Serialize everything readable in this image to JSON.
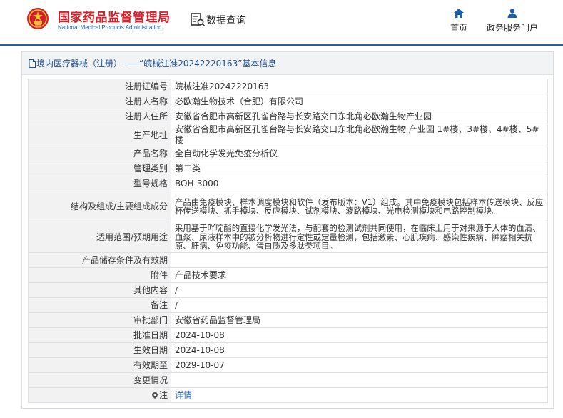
{
  "header": {
    "brand_cn": "国家药品监督管理局",
    "brand_en": "National Medical Products Administration",
    "database_label": "数据查询",
    "nav": [
      {
        "label": "首页",
        "icon": "home-icon"
      },
      {
        "label": "政务服务门户",
        "icon": "user-icon"
      }
    ]
  },
  "panel": {
    "title": "境内医疗器械（注册）——“皖械注准20242220163”基本信息",
    "rows": [
      {
        "key": "注册证编号",
        "value": "皖械注准20242220163"
      },
      {
        "key": "注册人名称",
        "value": "必欧瀚生物技术（合肥）有限公司"
      },
      {
        "key": "注册人住所",
        "value": "安徽省合肥市高新区孔雀台路与长安路交口东北角必欧瀚生物产业园"
      },
      {
        "key": "生产地址",
        "value": "安徽省合肥市高新区孔雀台路与长安路交口东北角必欧瀚生物 产业园 1#楼、3#楼、4#楼、5#楼"
      },
      {
        "key": "产品名称",
        "value": "全自动化学发光免疫分析仪"
      },
      {
        "key": "管理类别",
        "value": "第二类"
      },
      {
        "key": "型号规格",
        "value": "BOH-3000"
      },
      {
        "key": "结构及组成/主要组成成分",
        "value": "产品由免疫模块、样本调度模块和软件（发布版本：V1）组成。其中免疫模块包括样本传送模块、反应杯传送模块、抓手模块、反应模块、试剂模块、液路模块、光电检测模块和电路控制模块。"
      },
      {
        "key": "适用范围/预期用途",
        "value": "采用基于吖啶酯的直接化学发光法，与配套的检测试剂共同使用，在临床上用于对来源于人体的血清、血浆、尿液样本中的被分析物进行定性或定量检测，包括激素、心肌疾病、感染性疾病、肿瘤相关抗原、肝病、免疫功能、蛋白质及多肽类项目。"
      },
      {
        "key": "产品储存条件及有效期",
        "value": ""
      },
      {
        "key": "附件",
        "value": "产品技术要求"
      },
      {
        "key": "其他内容",
        "value": "/"
      },
      {
        "key": "备注",
        "value": "/"
      },
      {
        "key": "审批部门",
        "value": "安徽省药品监督管理局"
      },
      {
        "key": "批准日期",
        "value": "2024-10-08"
      },
      {
        "key": "生效日期",
        "value": "2024-10-08"
      },
      {
        "key": "有效期至",
        "value": "2029-10-07"
      },
      {
        "key": "变更情况",
        "value": ""
      },
      {
        "key": "注",
        "value": "详情"
      }
    ]
  },
  "colors": {
    "brand_red": "#d4202a",
    "brand_blue": "#1f5fa8",
    "link": "#2a6ebf",
    "key_cell_bg": "#f2f2f2"
  }
}
